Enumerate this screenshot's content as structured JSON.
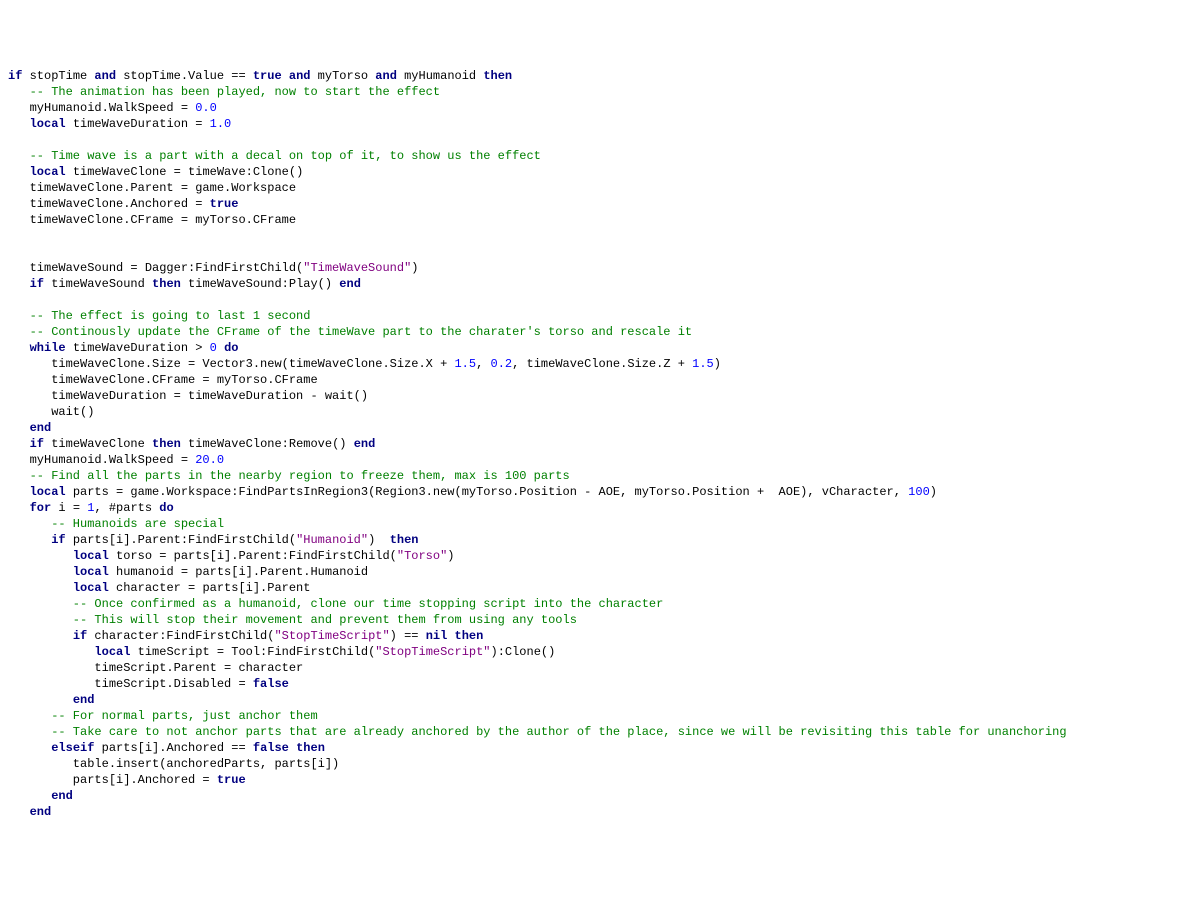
{
  "code": {
    "lines": [
      [
        [
          "kw",
          "if"
        ],
        [
          "id",
          " stopTime "
        ],
        [
          "kw",
          "and"
        ],
        [
          "id",
          " stopTime.Value == "
        ],
        [
          "bool",
          "true"
        ],
        [
          "id",
          " "
        ],
        [
          "kw",
          "and"
        ],
        [
          "id",
          " myTorso "
        ],
        [
          "kw",
          "and"
        ],
        [
          "id",
          " myHumanoid "
        ],
        [
          "kw",
          "then"
        ]
      ],
      [
        [
          "cm",
          "   -- The animation has been played, now to start the effect"
        ]
      ],
      [
        [
          "id",
          "   myHumanoid.WalkSpeed = "
        ],
        [
          "num",
          "0.0"
        ]
      ],
      [
        [
          "id",
          "   "
        ],
        [
          "kw",
          "local"
        ],
        [
          "id",
          " timeWaveDuration = "
        ],
        [
          "num",
          "1.0"
        ]
      ],
      [
        [
          "id",
          ""
        ]
      ],
      [
        [
          "cm",
          "   -- Time wave is a part with a decal on top of it, to show us the effect"
        ]
      ],
      [
        [
          "id",
          "   "
        ],
        [
          "kw",
          "local"
        ],
        [
          "id",
          " timeWaveClone = timeWave:Clone()"
        ]
      ],
      [
        [
          "id",
          "   timeWaveClone.Parent = game.Workspace"
        ]
      ],
      [
        [
          "id",
          "   timeWaveClone.Anchored = "
        ],
        [
          "bool",
          "true"
        ]
      ],
      [
        [
          "id",
          "   timeWaveClone.CFrame = myTorso.CFrame"
        ]
      ],
      [
        [
          "id",
          ""
        ]
      ],
      [
        [
          "id",
          ""
        ]
      ],
      [
        [
          "id",
          "   timeWaveSound = Dagger:FindFirstChild("
        ],
        [
          "str",
          "\"TimeWaveSound\""
        ],
        [
          "id",
          ")"
        ]
      ],
      [
        [
          "id",
          "   "
        ],
        [
          "kw",
          "if"
        ],
        [
          "id",
          " timeWaveSound "
        ],
        [
          "kw",
          "then"
        ],
        [
          "id",
          " timeWaveSound:Play() "
        ],
        [
          "kw",
          "end"
        ]
      ],
      [
        [
          "id",
          ""
        ]
      ],
      [
        [
          "cm",
          "   -- The effect is going to last 1 second"
        ]
      ],
      [
        [
          "cm",
          "   -- Continously update the CFrame of the timeWave part to the charater's torso and rescale it"
        ]
      ],
      [
        [
          "id",
          "   "
        ],
        [
          "kw",
          "while"
        ],
        [
          "id",
          " timeWaveDuration > "
        ],
        [
          "num",
          "0"
        ],
        [
          "id",
          " "
        ],
        [
          "kw",
          "do"
        ]
      ],
      [
        [
          "id",
          "      timeWaveClone.Size = Vector3.new(timeWaveClone.Size.X + "
        ],
        [
          "num",
          "1.5"
        ],
        [
          "id",
          ", "
        ],
        [
          "num",
          "0.2"
        ],
        [
          "id",
          ", timeWaveClone.Size.Z + "
        ],
        [
          "num",
          "1.5"
        ],
        [
          "id",
          ")"
        ]
      ],
      [
        [
          "id",
          "      timeWaveClone.CFrame = myTorso.CFrame"
        ]
      ],
      [
        [
          "id",
          "      timeWaveDuration = timeWaveDuration - wait()"
        ]
      ],
      [
        [
          "id",
          "      wait()"
        ]
      ],
      [
        [
          "id",
          "   "
        ],
        [
          "kw",
          "end"
        ]
      ],
      [
        [
          "id",
          "   "
        ],
        [
          "kw",
          "if"
        ],
        [
          "id",
          " timeWaveClone "
        ],
        [
          "kw",
          "then"
        ],
        [
          "id",
          " timeWaveClone:Remove() "
        ],
        [
          "kw",
          "end"
        ]
      ],
      [
        [
          "id",
          "   myHumanoid.WalkSpeed = "
        ],
        [
          "num",
          "20.0"
        ]
      ],
      [
        [
          "cm",
          "   -- Find all the parts in the nearby region to freeze them, max is 100 parts"
        ]
      ],
      [
        [
          "id",
          "   "
        ],
        [
          "kw",
          "local"
        ],
        [
          "id",
          " parts = game.Workspace:FindPartsInRegion3(Region3.new(myTorso.Position - AOE, myTorso.Position +  AOE), vCharacter, "
        ],
        [
          "num",
          "100"
        ],
        [
          "id",
          ")"
        ]
      ],
      [
        [
          "id",
          "   "
        ],
        [
          "kw",
          "for"
        ],
        [
          "id",
          " i = "
        ],
        [
          "num",
          "1"
        ],
        [
          "id",
          ", #parts "
        ],
        [
          "kw",
          "do"
        ]
      ],
      [
        [
          "cm",
          "      -- Humanoids are special"
        ]
      ],
      [
        [
          "id",
          "      "
        ],
        [
          "kw",
          "if"
        ],
        [
          "id",
          " parts[i].Parent:FindFirstChild("
        ],
        [
          "str",
          "\"Humanoid\""
        ],
        [
          "id",
          ")  "
        ],
        [
          "kw",
          "then"
        ]
      ],
      [
        [
          "id",
          "         "
        ],
        [
          "kw",
          "local"
        ],
        [
          "id",
          " torso = parts[i].Parent:FindFirstChild("
        ],
        [
          "str",
          "\"Torso\""
        ],
        [
          "id",
          ")"
        ]
      ],
      [
        [
          "id",
          "         "
        ],
        [
          "kw",
          "local"
        ],
        [
          "id",
          " humanoid = parts[i].Parent.Humanoid"
        ]
      ],
      [
        [
          "id",
          "         "
        ],
        [
          "kw",
          "local"
        ],
        [
          "id",
          " character = parts[i].Parent"
        ]
      ],
      [
        [
          "cm",
          "         -- Once confirmed as a humanoid, clone our time stopping script into the character"
        ]
      ],
      [
        [
          "cm",
          "         -- This will stop their movement and prevent them from using any tools"
        ]
      ],
      [
        [
          "id",
          "         "
        ],
        [
          "kw",
          "if"
        ],
        [
          "id",
          " character:FindFirstChild("
        ],
        [
          "str",
          "\"StopTimeScript\""
        ],
        [
          "id",
          ") == "
        ],
        [
          "bool",
          "nil"
        ],
        [
          "id",
          " "
        ],
        [
          "kw",
          "then"
        ]
      ],
      [
        [
          "id",
          "            "
        ],
        [
          "kw",
          "local"
        ],
        [
          "id",
          " timeScript = Tool:FindFirstChild("
        ],
        [
          "str",
          "\"StopTimeScript\""
        ],
        [
          "id",
          "):Clone()"
        ]
      ],
      [
        [
          "id",
          "            timeScript.Parent = character"
        ]
      ],
      [
        [
          "id",
          "            timeScript.Disabled = "
        ],
        [
          "bool",
          "false"
        ]
      ],
      [
        [
          "id",
          "         "
        ],
        [
          "kw",
          "end"
        ]
      ],
      [
        [
          "cm",
          "      -- For normal parts, just anchor them"
        ]
      ],
      [
        [
          "cm",
          "      -- Take care to not anchor parts that are already anchored by the author of the place, since we will be revisiting this table for unanchoring"
        ]
      ],
      [
        [
          "id",
          "      "
        ],
        [
          "kw",
          "elseif"
        ],
        [
          "id",
          " parts[i].Anchored == "
        ],
        [
          "bool",
          "false"
        ],
        [
          "id",
          " "
        ],
        [
          "kw",
          "then"
        ]
      ],
      [
        [
          "id",
          "         table.insert(anchoredParts, parts[i])"
        ]
      ],
      [
        [
          "id",
          "         parts[i].Anchored = "
        ],
        [
          "bool",
          "true"
        ]
      ],
      [
        [
          "id",
          "      "
        ],
        [
          "kw",
          "end"
        ]
      ],
      [
        [
          "id",
          "   "
        ],
        [
          "kw",
          "end"
        ]
      ]
    ]
  }
}
